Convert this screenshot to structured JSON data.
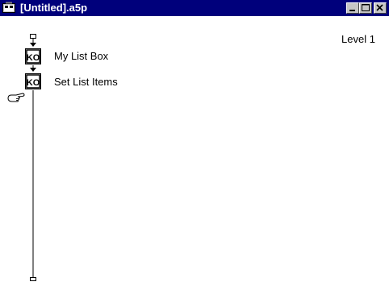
{
  "window": {
    "title": "[Untitled].a5p",
    "app_icon": "authorware-file-icon"
  },
  "title_buttons": {
    "minimize": "minimize-icon",
    "maximize": "maximize-icon",
    "close": "close-icon"
  },
  "flowline": {
    "level_label": "Level 1",
    "icons": [
      {
        "label": "My List Box",
        "glyph": "KO",
        "icon": "knowledge-object-icon"
      },
      {
        "label": "Set List Items",
        "glyph": "KO",
        "icon": "knowledge-object-icon"
      }
    ],
    "paste_hand_icon": "paste-hand-icon"
  },
  "colors": {
    "titlebar": "#00007b",
    "titlebar_text": "#ffffff",
    "background": "#ffffff"
  }
}
